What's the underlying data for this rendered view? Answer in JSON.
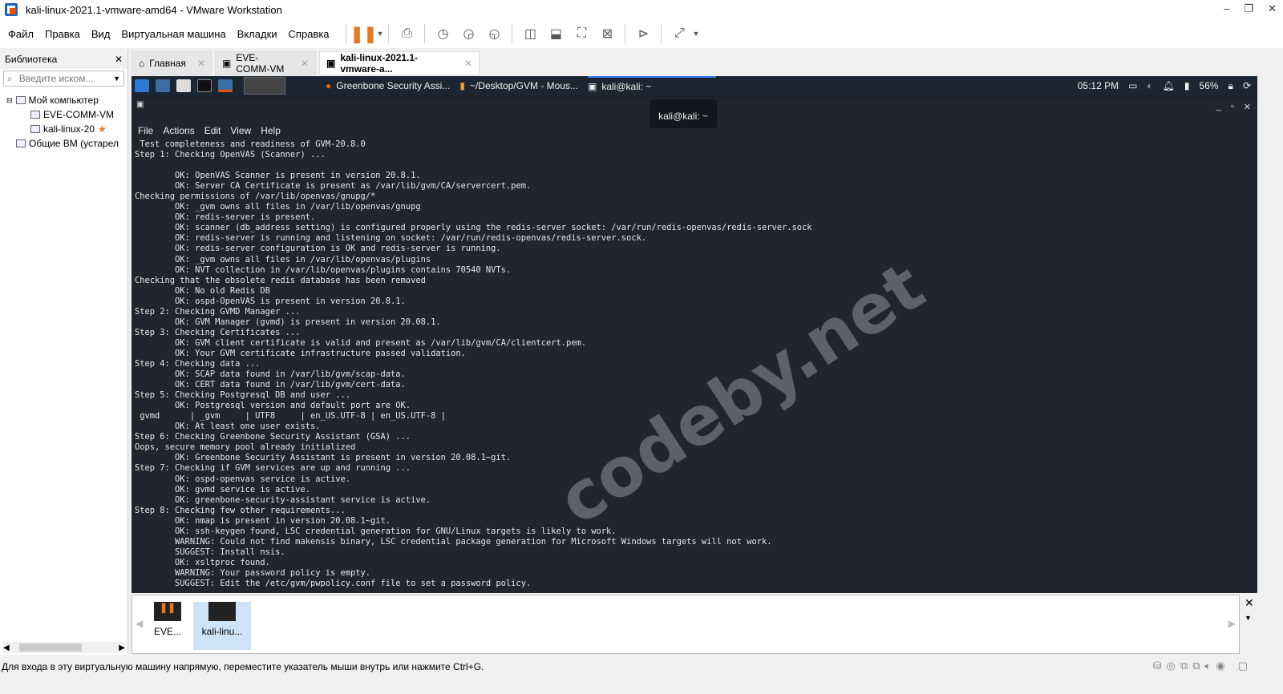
{
  "window": {
    "title": "kali-linux-2021.1-vmware-amd64 - VMware Workstation"
  },
  "menu": [
    "Файл",
    "Правка",
    "Вид",
    "Виртуальная машина",
    "Вкладки",
    "Справка"
  ],
  "library": {
    "title": "Библиотека",
    "search_placeholder": "Введите иском...",
    "tree": [
      "Мой компьютер",
      "EVE-COMM-VM",
      "kali-linux-20",
      "Общие ВМ (устарел"
    ]
  },
  "tabs": [
    {
      "label": "Главная"
    },
    {
      "label": "EVE-COMM-VM"
    },
    {
      "label": "kali-linux-2021.1-vmware-a..."
    }
  ],
  "kali_panel": {
    "tasks": [
      "Greenbone Security Assi...",
      "~/Desktop/GVM - Mous...",
      "kali@kali: ~"
    ],
    "time": "05:12 PM",
    "battery": "56%"
  },
  "terminal": {
    "tooltip": "kali@kali: ~",
    "menu": [
      "File",
      "Actions",
      "Edit",
      "View",
      "Help"
    ],
    "lines": [
      " Test completeness and readiness of GVM-20.8.0",
      "Step 1: Checking OpenVAS (Scanner) ...",
      "",
      "        OK: OpenVAS Scanner is present in version 20.8.1.",
      "        OK: Server CA Certificate is present as /var/lib/gvm/CA/servercert.pem.",
      "Checking permissions of /var/lib/openvas/gnupg/*",
      "        OK: _gvm owns all files in /var/lib/openvas/gnupg",
      "        OK: redis-server is present.",
      "        OK: scanner (db_address setting) is configured properly using the redis-server socket: /var/run/redis-openvas/redis-server.sock",
      "        OK: redis-server is running and listening on socket: /var/run/redis-openvas/redis-server.sock.",
      "        OK: redis-server configuration is OK and redis-server is running.",
      "        OK: _gvm owns all files in /var/lib/openvas/plugins",
      "        OK: NVT collection in /var/lib/openvas/plugins contains 70540 NVTs.",
      "Checking that the obsolete redis database has been removed",
      "        OK: No old Redis DB",
      "        OK: ospd-OpenVAS is present in version 20.8.1.",
      "Step 2: Checking GVMD Manager ...",
      "        OK: GVM Manager (gvmd) is present in version 20.08.1.",
      "Step 3: Checking Certificates ...",
      "        OK: GVM client certificate is valid and present as /var/lib/gvm/CA/clientcert.pem.",
      "        OK: Your GVM certificate infrastructure passed validation.",
      "Step 4: Checking data ...",
      "        OK: SCAP data found in /var/lib/gvm/scap-data.",
      "        OK: CERT data found in /var/lib/gvm/cert-data.",
      "Step 5: Checking Postgresql DB and user ...",
      "        OK: Postgresql version and default port are OK.",
      " gvmd      | _gvm     | UTF8     | en_US.UTF-8 | en_US.UTF-8 |",
      "        OK: At least one user exists.",
      "Step 6: Checking Greenbone Security Assistant (GSA) ...",
      "Oops, secure memory pool already initialized",
      "        OK: Greenbone Security Assistant is present in version 20.08.1~git.",
      "Step 7: Checking if GVM services are up and running ...",
      "        OK: ospd-openvas service is active.",
      "        OK: gvmd service is active.",
      "        OK: greenbone-security-assistant service is active.",
      "Step 8: Checking few other requirements...",
      "        OK: nmap is present in version 20.08.1~git.",
      "        OK: ssh-keygen found, LSC credential generation for GNU/Linux targets is likely to work.",
      "        WARNING: Could not find makensis binary, LSC credential package generation for Microsoft Windows targets will not work.",
      "        SUGGEST: Install nsis.",
      "        OK: xsltproc found.",
      "        WARNING: Your password policy is empty.",
      "        SUGGEST: Edit the /etc/gvm/pwpolicy.conf file to set a password policy."
    ]
  },
  "watermark": "codeby.net",
  "thumbnails": [
    "EVE...",
    "kali-linu..."
  ],
  "status": "Для входа в эту виртуальную машину напрямую, переместите указатель мыши внутрь или нажмите Ctrl+G."
}
